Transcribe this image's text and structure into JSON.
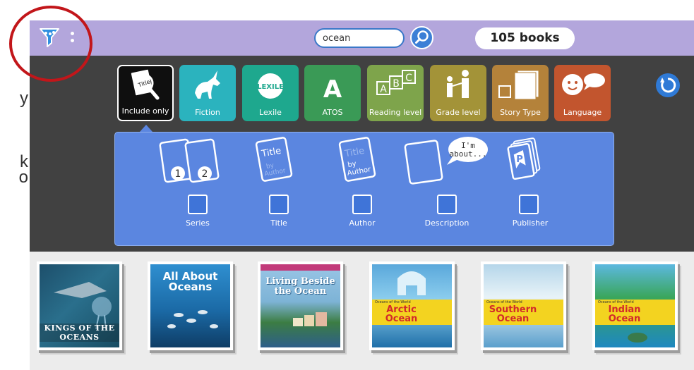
{
  "edge_fragments": [
    "y",
    "k",
    "o"
  ],
  "topbar": {
    "filter_icon": "funnel-icon",
    "more_icon": "vertical-dots-icon",
    "search_value": "ocean",
    "search_icon": "magnifier-icon",
    "book_count": "105 books"
  },
  "filter_chips": [
    {
      "label": "Include only",
      "icon": "title-magnifier-icon",
      "color": "#0f0f0f",
      "active": true
    },
    {
      "label": "Fiction",
      "icon": "unicorn-icon",
      "color": "#2bb3be"
    },
    {
      "label": "Lexile",
      "icon": "lexile-logo-icon",
      "color": "#1ea88e"
    },
    {
      "label": "ATOS",
      "icon": "letter-a-icon",
      "color": "#3a9a56"
    },
    {
      "label": "Reading level",
      "icon": "abc-blocks-icon",
      "color": "#7ea44b"
    },
    {
      "label": "Grade level",
      "icon": "people-icon",
      "color": "#a39338"
    },
    {
      "label": "Story Type",
      "icon": "pages-icon",
      "color": "#b4823a"
    },
    {
      "label": "Language",
      "icon": "speech-face-icon",
      "color": "#c2552e"
    }
  ],
  "reset_icon": "refresh-icon",
  "include_options": [
    {
      "label": "Series",
      "icon": "series-books-icon",
      "icon_text": [
        "1",
        "2"
      ],
      "checked": false
    },
    {
      "label": "Title",
      "icon": "title-book-icon",
      "icon_text": [
        "Title",
        "by",
        "Author"
      ],
      "checked": false
    },
    {
      "label": "Author",
      "icon": "author-book-icon",
      "icon_text": [
        "Title",
        "by",
        "Author"
      ],
      "checked": false
    },
    {
      "label": "Description",
      "icon": "description-book-icon",
      "icon_text": [
        "I'm",
        "about..."
      ],
      "checked": false
    },
    {
      "label": "Publisher",
      "icon": "publisher-books-icon",
      "icon_text": [
        "P"
      ],
      "checked": false
    }
  ],
  "books": [
    {
      "cover_title": "KINGS OF THE OCEANS",
      "bg": "#2a6f8c"
    },
    {
      "cover_title": "All About Oceans",
      "bg": "#1b7ab8"
    },
    {
      "cover_title": "Living Beside the Ocean",
      "bg": "#7db3d6"
    },
    {
      "cover_title": "Arctic Ocean",
      "series": "Oceans of the World",
      "bg": "#69b7e0"
    },
    {
      "cover_title": "Southern Ocean",
      "series": "Oceans of the World",
      "bg": "#9fcbe6"
    },
    {
      "cover_title": "Indian Ocean",
      "series": "Oceans of the World",
      "bg": "#3e9ac9"
    }
  ]
}
